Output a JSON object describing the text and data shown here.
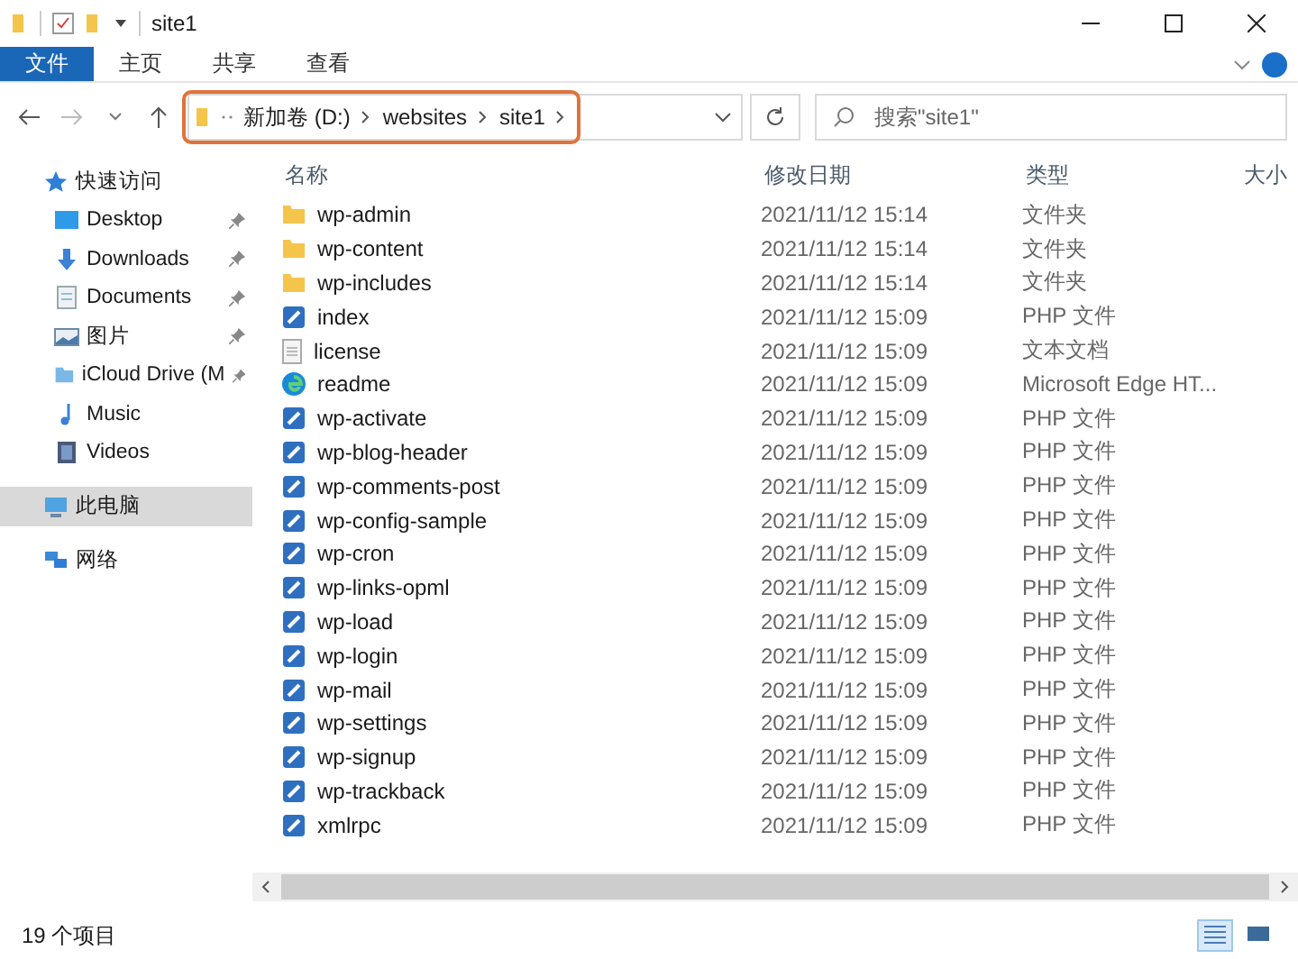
{
  "window": {
    "title": "site1"
  },
  "ribbon_tabs": [
    {
      "label": "文件",
      "selected": true
    },
    {
      "label": "主页",
      "selected": false
    },
    {
      "label": "共享",
      "selected": false
    },
    {
      "label": "查看",
      "selected": false
    }
  ],
  "address": {
    "crumbs": [
      "新加卷 (D:)",
      "websites",
      "site1"
    ]
  },
  "search": {
    "placeholder": "搜索\"site1\""
  },
  "sidebar": {
    "items": [
      {
        "label": "快速访问",
        "kind": "star",
        "selected": false,
        "children": [
          {
            "label": "Desktop",
            "kind": "desktop",
            "pinned": true
          },
          {
            "label": "Downloads",
            "kind": "download",
            "pinned": true
          },
          {
            "label": "Documents",
            "kind": "document",
            "pinned": true
          },
          {
            "label": "图片",
            "kind": "pictures",
            "pinned": true
          },
          {
            "label": "iCloud Drive (M",
            "kind": "cloud",
            "pinned": true
          },
          {
            "label": "Music",
            "kind": "music",
            "pinned": false
          },
          {
            "label": "Videos",
            "kind": "video",
            "pinned": false
          }
        ]
      },
      {
        "label": "此电脑",
        "kind": "pc",
        "selected": true
      },
      {
        "label": "网络",
        "kind": "network",
        "selected": false
      }
    ]
  },
  "table": {
    "columns": [
      "名称",
      "修改日期",
      "类型",
      "大小"
    ],
    "rows": [
      {
        "kind": "folder",
        "name": "wp-admin",
        "date": "2021/11/12 15:14",
        "type": "文件夹"
      },
      {
        "kind": "folder",
        "name": "wp-content",
        "date": "2021/11/12 15:14",
        "type": "文件夹"
      },
      {
        "kind": "folder",
        "name": "wp-includes",
        "date": "2021/11/12 15:14",
        "type": "文件夹"
      },
      {
        "kind": "php",
        "name": "index",
        "date": "2021/11/12 15:09",
        "type": "PHP 文件"
      },
      {
        "kind": "text",
        "name": "license",
        "date": "2021/11/12 15:09",
        "type": "文本文档"
      },
      {
        "kind": "edge",
        "name": "readme",
        "date": "2021/11/12 15:09",
        "type": "Microsoft Edge HT..."
      },
      {
        "kind": "php",
        "name": "wp-activate",
        "date": "2021/11/12 15:09",
        "type": "PHP 文件"
      },
      {
        "kind": "php",
        "name": "wp-blog-header",
        "date": "2021/11/12 15:09",
        "type": "PHP 文件"
      },
      {
        "kind": "php",
        "name": "wp-comments-post",
        "date": "2021/11/12 15:09",
        "type": "PHP 文件"
      },
      {
        "kind": "php",
        "name": "wp-config-sample",
        "date": "2021/11/12 15:09",
        "type": "PHP 文件"
      },
      {
        "kind": "php",
        "name": "wp-cron",
        "date": "2021/11/12 15:09",
        "type": "PHP 文件"
      },
      {
        "kind": "php",
        "name": "wp-links-opml",
        "date": "2021/11/12 15:09",
        "type": "PHP 文件"
      },
      {
        "kind": "php",
        "name": "wp-load",
        "date": "2021/11/12 15:09",
        "type": "PHP 文件"
      },
      {
        "kind": "php",
        "name": "wp-login",
        "date": "2021/11/12 15:09",
        "type": "PHP 文件"
      },
      {
        "kind": "php",
        "name": "wp-mail",
        "date": "2021/11/12 15:09",
        "type": "PHP 文件"
      },
      {
        "kind": "php",
        "name": "wp-settings",
        "date": "2021/11/12 15:09",
        "type": "PHP 文件"
      },
      {
        "kind": "php",
        "name": "wp-signup",
        "date": "2021/11/12 15:09",
        "type": "PHP 文件"
      },
      {
        "kind": "php",
        "name": "wp-trackback",
        "date": "2021/11/12 15:09",
        "type": "PHP 文件"
      },
      {
        "kind": "php",
        "name": "xmlrpc",
        "date": "2021/11/12 15:09",
        "type": "PHP 文件"
      }
    ]
  },
  "status_bar": {
    "count": "19 个项目"
  }
}
